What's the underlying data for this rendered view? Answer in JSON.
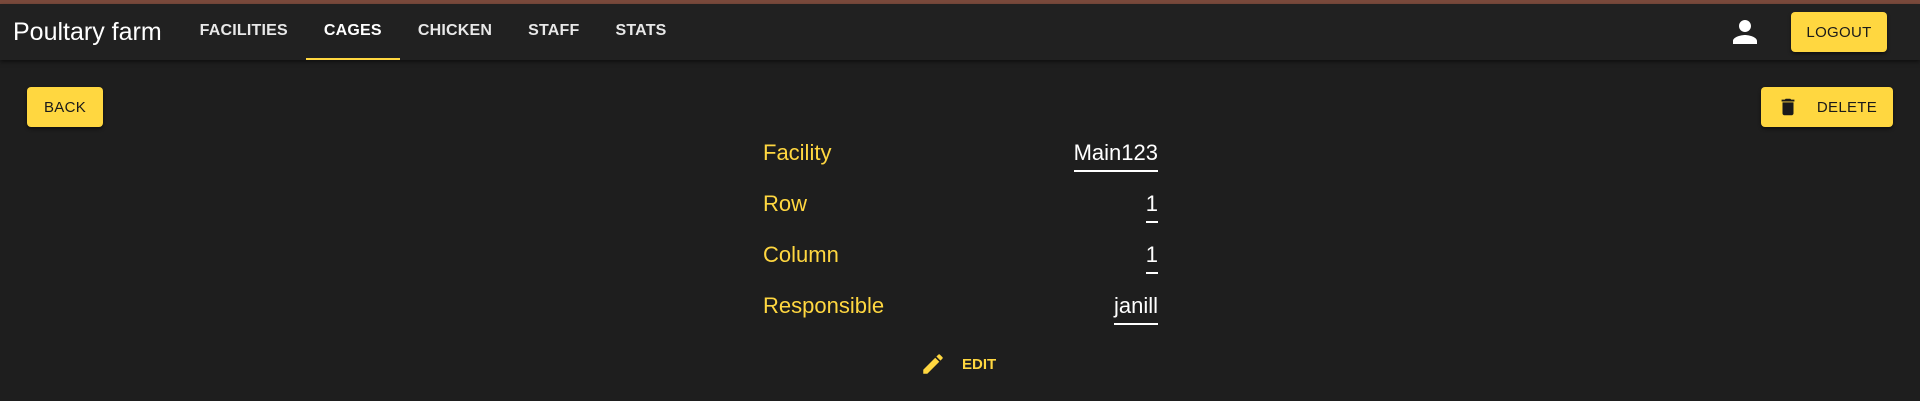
{
  "app": {
    "title": "Poultary farm"
  },
  "nav": {
    "tabs": [
      {
        "label": "FACILITIES",
        "active": false
      },
      {
        "label": "CAGES",
        "active": true
      },
      {
        "label": "CHICKEN",
        "active": false
      },
      {
        "label": "STAFF",
        "active": false
      },
      {
        "label": "STATS",
        "active": false
      }
    ]
  },
  "header": {
    "account_icon": "account-icon",
    "logout_label": "LOGOUT"
  },
  "actions": {
    "back_label": "BACK",
    "delete_label": "DELETE",
    "delete_icon": "trash-icon",
    "edit_label": "EDIT",
    "edit_icon": "pencil-icon"
  },
  "cage": {
    "fields": [
      {
        "label": "Facility",
        "value": "Main123"
      },
      {
        "label": "Row",
        "value": "1"
      },
      {
        "label": "Column",
        "value": "1"
      },
      {
        "label": "Responsible",
        "value": "janill"
      }
    ]
  },
  "colors": {
    "accent": "#ffd740",
    "background": "#1e1e1e",
    "appbar": "#212121",
    "top_strip": "#7a4a3c"
  }
}
